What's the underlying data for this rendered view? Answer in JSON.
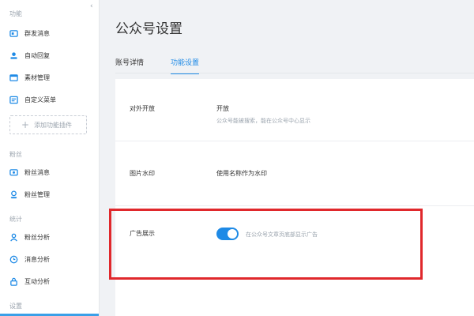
{
  "sidebar": {
    "sections": {
      "features": "功能",
      "fans": "粉丝",
      "stats": "统计",
      "settings": "设置"
    },
    "items": {
      "mass_send": {
        "label": "群发消息",
        "icon": "message-icon"
      },
      "auto_reply": {
        "label": "自动回复",
        "icon": "user-reply-icon"
      },
      "material": {
        "label": "素材管理",
        "icon": "folder-icon"
      },
      "custom_menu": {
        "label": "自定义菜单",
        "icon": "menu-icon"
      },
      "add_plugin": "添加功能插件",
      "fan_messages": {
        "label": "粉丝消息",
        "icon": "chat-icon"
      },
      "fan_manage": {
        "label": "粉丝管理",
        "icon": "people-icon"
      },
      "fan_analysis": {
        "label": "粉丝分析",
        "icon": "person-icon"
      },
      "message_analysis": {
        "label": "消息分析",
        "icon": "clock-icon"
      },
      "interaction_analysis": {
        "label": "互动分析",
        "icon": "lock-icon"
      }
    },
    "collapse": "‹"
  },
  "main": {
    "title": "公众号设置",
    "tabs": [
      {
        "label": "账号详情",
        "active": false
      },
      {
        "label": "功能设置",
        "active": true
      }
    ],
    "settings": {
      "open": {
        "label": "对外开放",
        "value": "开放",
        "description": "公众号能被搜索，能在公众号中心显示"
      },
      "watermark": {
        "label": "图片水印",
        "value": "使用名称作为水印"
      },
      "ads": {
        "label": "广告展示",
        "enabled": true,
        "description": "在公众号文章页底部显示广告"
      }
    }
  },
  "colors": {
    "accent": "#1e8ae6",
    "highlight": "#e0282c"
  }
}
